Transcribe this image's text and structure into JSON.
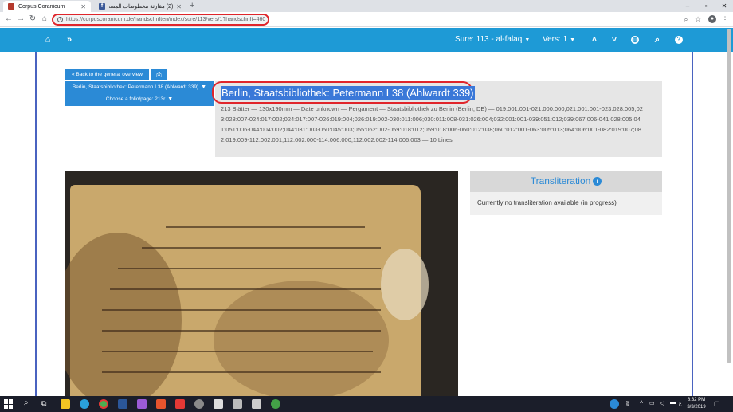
{
  "browser": {
    "tabs": [
      {
        "title": "Corpus Coranicum",
        "active": true
      },
      {
        "title": "(2) مقارنة مخطوطات المصحف",
        "active": false
      }
    ],
    "new_tab": "+",
    "url": "https://corpuscoranicum.de/handschriften/index/sure/113/vers/1?handschrift=460",
    "window_controls": [
      "–",
      "▫",
      "✕"
    ],
    "toolbar_icons": [
      "search-icon",
      "star-icon",
      "profile-icon",
      "menu-icon"
    ]
  },
  "sitenav": {
    "sura": "Sure: 113 - al-falaq",
    "verse": "Vers: 1",
    "icons": [
      "home-icon",
      "forward-icon",
      "chevron-up-icon",
      "chevron-down-icon",
      "globe-icon",
      "search-icon",
      "help-icon"
    ]
  },
  "manuscript": {
    "back_label": "« Back to the general overview",
    "print_label": "⎙",
    "selector_label": "Berlin, Staatsbibliothek: Petermann I 38 (Ahlwardt 339)",
    "folio_label": "Choose a folio/page: 213r",
    "title": "Berlin, Staatsbibliothek: Petermann I 38 (Ahlwardt 339)",
    "description": "213 Blätter — 130x190mm — Date unknown — Pergament — Staatsbibliothek zu Berlin (Berlin, DE) — 019:001:001-021:000:000;021:001:001-023:028:005;023:028:007-024:017:002;024:017:007-026:019:004;026:019:002-030:011:006;030:011:008-031:026:004;032:001:001-039:051:012;039:067:006-041:028:005;041:051:006-044:004:002;044:031:003-050:045:003;055:062:002-059:018:012;059:018:006-060:012:038;060:012:001-063:005:013;064:006:001-082:019:007;082:019:009-112:002:001;112:002:000-114:006:000;112:002:002-114:006:003 — 10 Lines"
  },
  "transliteration": {
    "heading": "Transliteration",
    "body": "Currently no transliteration available (in progress)"
  },
  "taskbar": {
    "time": "8:32 PM",
    "date": "3/3/2019",
    "lang": "ع"
  },
  "colors": {
    "nav_blue": "#1e9ad6",
    "button_blue": "#2b8ad6",
    "highlight_red": "#e0252b"
  }
}
